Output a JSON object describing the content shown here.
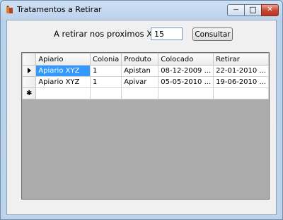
{
  "window": {
    "title": "Tratamentos a Retirar",
    "controls": {
      "minimize": "—",
      "maximize": "□",
      "close": "✕"
    }
  },
  "form": {
    "days_label": "A retirar nos proximos X dias:",
    "days_value": "15",
    "consult_label": "Consultar"
  },
  "grid": {
    "columns": [
      "Apiario",
      "Colonia",
      "Produto",
      "Colocado",
      "Retirar"
    ],
    "rows": [
      [
        "Apiario XYZ",
        "1",
        "Apistan",
        "08-12-2009 ...",
        "22-01-2010 ..."
      ],
      [
        "Apiario XYZ",
        "1",
        "Apivar",
        "05-05-2010 ...",
        "19-06-2010 ..."
      ]
    ],
    "new_row_marker": "✱"
  }
}
